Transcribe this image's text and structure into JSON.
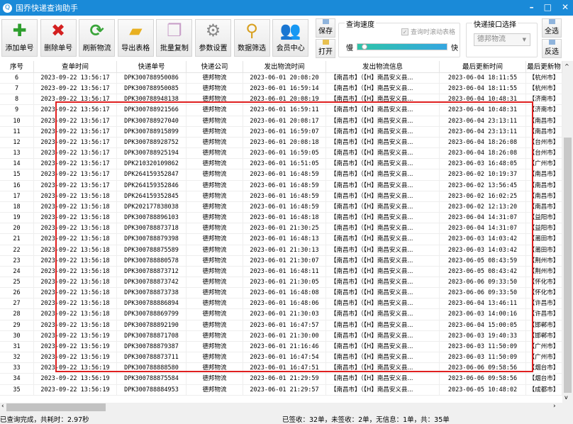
{
  "title": "国乔快递查询助手",
  "toolbar": [
    {
      "label": "添加单号",
      "icon": "plus-icon",
      "color": "#2e9e2e",
      "glyph": "✚"
    },
    {
      "label": "删除单号",
      "icon": "delete-x-icon",
      "color": "#d42020",
      "glyph": "✖"
    },
    {
      "label": "刷新物流",
      "icon": "refresh-icon",
      "color": "#3aa53a",
      "glyph": "⟳"
    },
    {
      "label": "导出表格",
      "icon": "folder-export-icon",
      "color": "#e8b020",
      "glyph": "▰"
    },
    {
      "label": "批量复制",
      "icon": "copy-pages-icon",
      "color": "#c9a0c9",
      "glyph": "❐"
    },
    {
      "label": "参数设置",
      "icon": "gear-icon",
      "color": "#888888",
      "glyph": "⚙"
    },
    {
      "label": "数据筛选",
      "icon": "search-folder-icon",
      "color": "#d8a020",
      "glyph": "⚲"
    },
    {
      "label": "会员中心",
      "icon": "users-icon",
      "color": "#c04040",
      "glyph": "👥"
    }
  ],
  "side": {
    "save": "保存",
    "open": "打开",
    "select_all": "全选",
    "invert": "反选"
  },
  "speed": {
    "label": "查询速度",
    "scroll_check": "查询时滚动表格",
    "slow": "慢",
    "fast": "快",
    "value": 0.05
  },
  "api": {
    "label": "快递接口选择",
    "selected": "德邦物流"
  },
  "columns": [
    "序号",
    "查单时间",
    "快递单号",
    "快递公司",
    "发出物流时间",
    "发出物流信息",
    "最后更新时间",
    "最后更新物"
  ],
  "rows": [
    [
      "6",
      "2023-09-22 13:56:17",
      "DPK300788950086",
      "德邦物流",
      "2023-06-01 20:08:20",
      "【南昌市】（【H】南昌安义县...",
      "2023-06-04 18:11:55",
      "【杭州市】"
    ],
    [
      "7",
      "2023-09-22 13:56:17",
      "DPK300788950085",
      "德邦物流",
      "2023-06-01 16:59:14",
      "【南昌市】（【H】南昌安义县...",
      "2023-06-04 18:11:55",
      "【杭州市】"
    ],
    [
      "8",
      "2023-09-22 13:56:17",
      "DPK300788948138",
      "德邦物流",
      "2023-06-01 20:08:19",
      "【南昌市】（【H】南昌安义县...",
      "2023-06-04 10:48:31",
      "【济南市】"
    ],
    [
      "9",
      "2023-09-22 13:56:17",
      "DPK300788921566",
      "德邦物流",
      "2023-06-01 16:59:11",
      "【南昌市】（【H】南昌安义县...",
      "2023-06-04 10:48:31",
      "【济南市】"
    ],
    [
      "10",
      "2023-09-22 13:56:17",
      "DPK300788927040",
      "德邦物流",
      "2023-06-01 20:08:17",
      "【南昌市】（【H】南昌安义县...",
      "2023-06-04 23:13:11",
      "【南昌市】"
    ],
    [
      "11",
      "2023-09-22 13:56:17",
      "DPK300788915899",
      "德邦物流",
      "2023-06-01 16:59:07",
      "【南昌市】（【H】南昌安义县...",
      "2023-06-04 23:13:11",
      "【南昌市】"
    ],
    [
      "12",
      "2023-09-22 13:56:17",
      "DPK300788928752",
      "德邦物流",
      "2023-06-01 20:08:18",
      "【南昌市】（【H】南昌安义县...",
      "2023-06-04 18:26:08",
      "【台州市】"
    ],
    [
      "13",
      "2023-09-22 13:56:17",
      "DPK300788925194",
      "德邦物流",
      "2023-06-01 16:59:05",
      "【南昌市】（【H】南昌安义县...",
      "2023-06-04 18:26:08",
      "【台州市】"
    ],
    [
      "14",
      "2023-09-22 13:56:17",
      "DPK210320109862",
      "德邦物流",
      "2023-06-01 16:51:05",
      "【南昌市】（【H】南昌安义县...",
      "2023-06-03 16:48:05",
      "【广州市】"
    ],
    [
      "15",
      "2023-09-22 13:56:17",
      "DPK264159352847",
      "德邦物流",
      "2023-06-01 16:48:59",
      "【南昌市】（【H】南昌安义县...",
      "2023-06-02 10:19:37",
      "【南昌市】"
    ],
    [
      "16",
      "2023-09-22 13:56:17",
      "DPK264159352846",
      "德邦物流",
      "2023-06-01 16:48:59",
      "【南昌市】（【H】南昌安义县...",
      "2023-06-02 13:56:45",
      "【南昌市】"
    ],
    [
      "17",
      "2023-09-22 13:56:18",
      "DPK264159352845",
      "德邦物流",
      "2023-06-01 16:48:59",
      "【南昌市】（【H】南昌安义县...",
      "2023-06-02 16:02:25",
      "【南昌市】"
    ],
    [
      "18",
      "2023-09-22 13:56:18",
      "DPK202177838038",
      "德邦物流",
      "2023-06-01 16:48:59",
      "【南昌市】（【H】南昌安义县...",
      "2023-06-02 12:13:20",
      "【南昌市】"
    ],
    [
      "19",
      "2023-09-22 13:56:18",
      "DPK300788896103",
      "德邦物流",
      "2023-06-01 16:48:18",
      "【南昌市】（【H】南昌安义县...",
      "2023-06-04 14:31:07",
      "【益阳市】"
    ],
    [
      "20",
      "2023-09-22 13:56:18",
      "DPK300788873718",
      "德邦物流",
      "2023-06-01 21:30:25",
      "【南昌市】（【H】南昌安义县...",
      "2023-06-04 14:31:07",
      "【益阳市】"
    ],
    [
      "21",
      "2023-09-22 13:56:18",
      "DPK300788879398",
      "德邦物流",
      "2023-06-01 16:48:13",
      "【南昌市】（【H】南昌安义县...",
      "2023-06-03 14:03:42",
      "【莆田市】"
    ],
    [
      "22",
      "2023-09-22 13:56:18",
      "DPK300788875589",
      "德邦物流",
      "2023-06-01 21:30:13",
      "【南昌市】（【H】南昌安义县...",
      "2023-06-03 14:03:42",
      "【莆田市】"
    ],
    [
      "23",
      "2023-09-22 13:56:18",
      "DPK300788880578",
      "德邦物流",
      "2023-06-01 21:30:07",
      "【南昌市】（【H】南昌安义县...",
      "2023-06-05 08:43:59",
      "【荆州市】"
    ],
    [
      "24",
      "2023-09-22 13:56:18",
      "DPK300788873712",
      "德邦物流",
      "2023-06-01 16:48:11",
      "【南昌市】（【H】南昌安义县...",
      "2023-06-05 08:43:42",
      "【荆州市】"
    ],
    [
      "25",
      "2023-09-22 13:56:18",
      "DPK300788873742",
      "德邦物流",
      "2023-06-01 21:30:05",
      "【南昌市】（【H】南昌安义县...",
      "2023-06-06 09:33:50",
      "【怀化市】"
    ],
    [
      "26",
      "2023-09-22 13:56:18",
      "DPK300788873738",
      "德邦物流",
      "2023-06-01 16:48:08",
      "【南昌市】（【H】南昌安义县...",
      "2023-06-06 09:33:50",
      "【怀化市】"
    ],
    [
      "27",
      "2023-09-22 13:56:18",
      "DPK300788886894",
      "德邦物流",
      "2023-06-01 16:48:06",
      "【南昌市】（【H】南昌安义县...",
      "2023-06-04 13:46:11",
      "【许昌市】"
    ],
    [
      "28",
      "2023-09-22 13:56:18",
      "DPK300788869799",
      "德邦物流",
      "2023-06-01 21:30:03",
      "【南昌市】（【H】南昌安义县...",
      "2023-06-03 14:00:16",
      "【许昌市】"
    ],
    [
      "29",
      "2023-09-22 13:56:18",
      "DPK300788892190",
      "德邦物流",
      "2023-06-01 16:47:57",
      "【南昌市】（【H】南昌安义县...",
      "2023-06-04 15:00:05",
      "【邯郸市】"
    ],
    [
      "30",
      "2023-09-22 13:56:19",
      "DPK300788871708",
      "德邦物流",
      "2023-06-01 21:30:00",
      "【南昌市】（【H】南昌安义县...",
      "2023-06-03 19:40:33",
      "【邯郸市】"
    ],
    [
      "31",
      "2023-09-22 13:56:19",
      "DPK300788879387",
      "德邦物流",
      "2023-06-01 21:16:46",
      "【南昌市】（【H】南昌安义县...",
      "2023-06-03 11:50:09",
      "【广州市】"
    ],
    [
      "32",
      "2023-09-22 13:56:19",
      "DPK300788873711",
      "德邦物流",
      "2023-06-01 16:47:54",
      "【南昌市】（【H】南昌安义县...",
      "2023-06-03 11:50:09",
      "【广州市】"
    ],
    [
      "33",
      "2023-09-22 13:56:19",
      "DPK300788888580",
      "德邦物流",
      "2023-06-01 16:47:51",
      "【南昌市】（【H】南昌安义县...",
      "2023-06-06 09:58:56",
      "【烟台市】"
    ],
    [
      "34",
      "2023-09-22 13:56:19",
      "DPK300788875584",
      "德邦物流",
      "2023-06-01 21:29:59",
      "【南昌市】（【H】南昌安义县...",
      "2023-06-06 09:58:56",
      "【烟台市】"
    ],
    [
      "35",
      "2023-09-22 13:56:19",
      "DPK300788884953",
      "德邦物流",
      "2023-06-01 21:29:57",
      "【南昌市】（【H】南昌安义县...",
      "2023-06-05 10:48:02",
      "【成都市】"
    ]
  ],
  "status": {
    "left": "已查询完成，共耗时：2.97秒",
    "right": "已签收：32单，未签收：2单，无信息：1单，共：35单"
  }
}
